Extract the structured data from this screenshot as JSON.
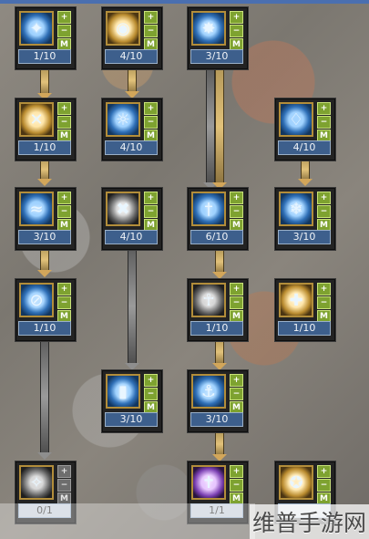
{
  "buttons": {
    "plus": "+",
    "minus": "−",
    "max": "M"
  },
  "watermark": "维普手游网",
  "skills": [
    {
      "level": "1/10",
      "icon_name": "frost-orb-icon"
    },
    {
      "level": "4/10",
      "icon_name": "holy-glow-icon"
    },
    {
      "level": "3/10",
      "icon_name": "ice-burst-icon"
    },
    {
      "level": "1/10",
      "icon_name": "cross-seal-icon"
    },
    {
      "level": "4/10",
      "icon_name": "spirit-aura-icon"
    },
    {
      "level": "4/10",
      "icon_name": "angel-aura-icon"
    },
    {
      "level": "3/10",
      "icon_name": "wind-slash-icon"
    },
    {
      "level": "4/10",
      "icon_name": "x-strike-icon"
    },
    {
      "level": "6/10",
      "icon_name": "sword-light-icon"
    },
    {
      "level": "3/10",
      "icon_name": "frost-guard-icon"
    },
    {
      "level": "1/10",
      "icon_name": "water-rune-icon"
    },
    {
      "level": "1/10",
      "icon_name": "ankh-icon"
    },
    {
      "level": "1/10",
      "icon_name": "holy-cross-icon"
    },
    {
      "level": "3/10",
      "icon_name": "ice-pillar-icon"
    },
    {
      "level": "3/10",
      "icon_name": "anchor-rune-icon"
    },
    {
      "level": "0/1",
      "icon_name": "shadow-rune-icon"
    },
    {
      "level": "1/1",
      "icon_name": "sacred-cross-icon"
    },
    {
      "level": "",
      "icon_name": "golden-seal-icon"
    }
  ]
}
